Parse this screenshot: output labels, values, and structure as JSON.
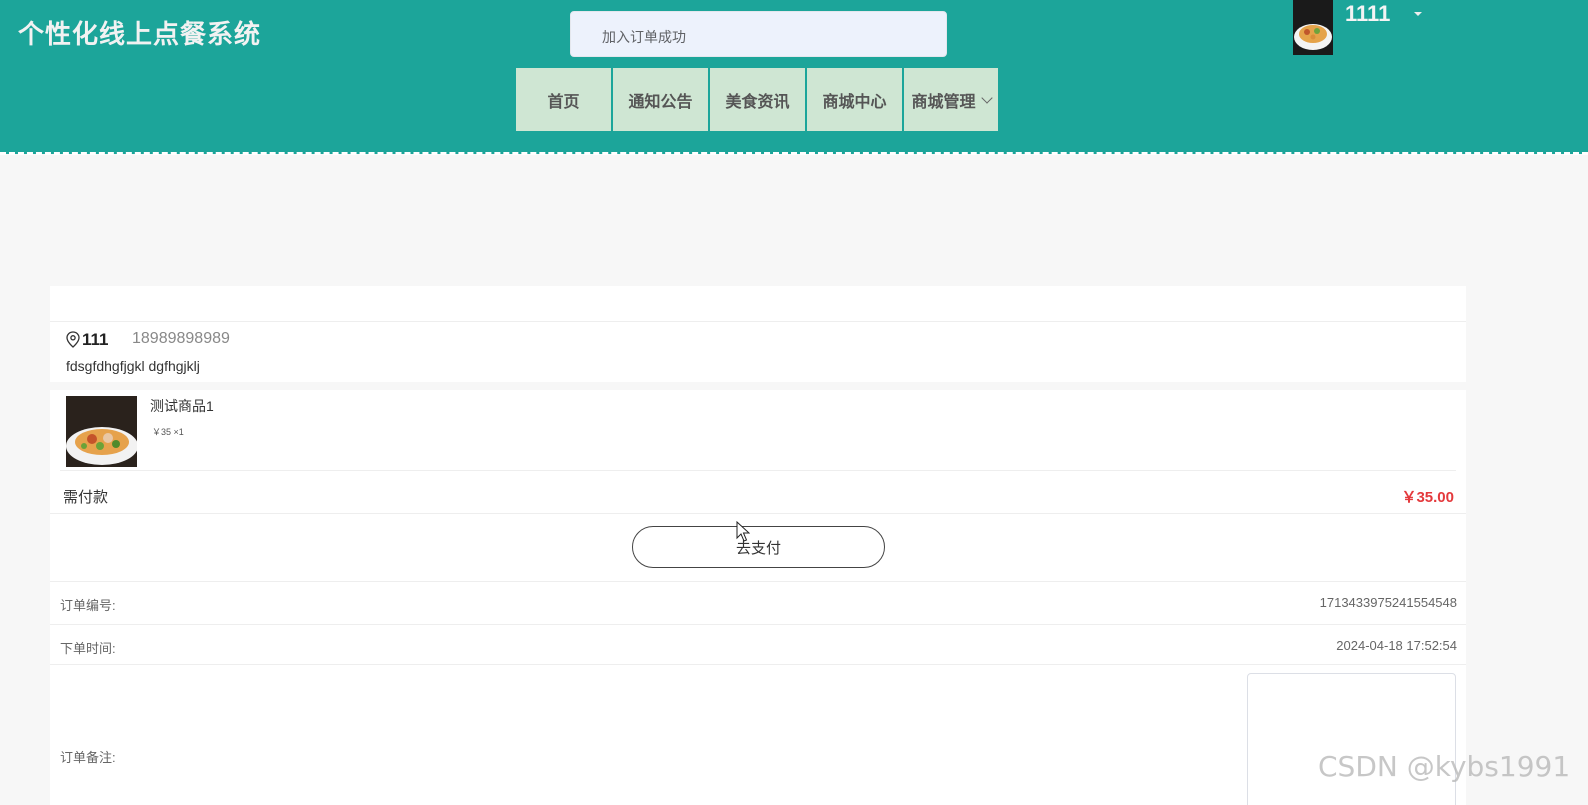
{
  "app": {
    "title": "个性化线上点餐系统"
  },
  "toast": {
    "message": "加入订单成功"
  },
  "nav": {
    "items": [
      {
        "label": "首页"
      },
      {
        "label": "通知公告"
      },
      {
        "label": "美食资讯"
      },
      {
        "label": "商城中心"
      },
      {
        "label": "商城管理"
      }
    ]
  },
  "user": {
    "name": "1111"
  },
  "address": {
    "name": "111",
    "phone": "18989898989",
    "detail": "fdsgfdhgfjgkl dgfhgjklj"
  },
  "goods": [
    {
      "name": "测试商品1",
      "price_line": "￥35 ×1"
    }
  ],
  "payment": {
    "label": "需付款",
    "amount": "￥35.00",
    "button": "去支付"
  },
  "order": {
    "number_label": "订单编号:",
    "number_value": "1713433975241554548",
    "time_label": "下单时间:",
    "time_value": "2024-04-18 17:52:54",
    "note_label": "订单备注:"
  },
  "watermark": "CSDN @kybs1991",
  "colors": {
    "header_bg": "#1ca59a",
    "nav_bg": "#cfe6d3",
    "price": "#e4393c"
  }
}
